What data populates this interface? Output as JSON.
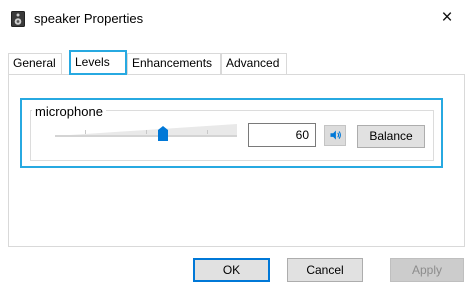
{
  "window": {
    "title": "speaker Properties",
    "close_glyph": "×",
    "app_icon": "speaker-icon"
  },
  "tabs": [
    {
      "label": "General",
      "active": false
    },
    {
      "label": "Levels",
      "active": true
    },
    {
      "label": "Enhancements",
      "active": false
    },
    {
      "label": "Advanced",
      "active": false
    }
  ],
  "levels": {
    "group_label": "microphone",
    "slider_value": 60,
    "slider_max": 100,
    "value_text": "60",
    "mute_icon": "speaker-volume-icon",
    "balance_label": "Balance"
  },
  "buttons": {
    "ok": "OK",
    "cancel": "Cancel",
    "apply": "Apply"
  },
  "colors": {
    "accent": "#27a9e1",
    "slider_thumb": "#0078d7",
    "default_button_border": "#0078d7"
  }
}
